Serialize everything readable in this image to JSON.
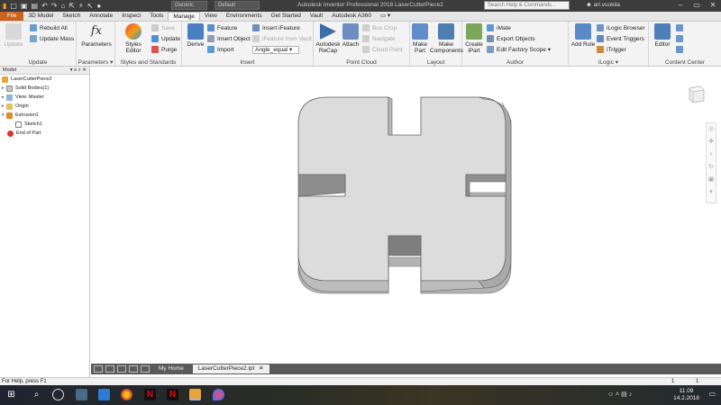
{
  "titlebar": {
    "title": "Autodesk Inventor Professional 2018    LaserCutterPiece2",
    "search_placeholder": "Search Help & Commands...",
    "user": "ari.vuokila",
    "appearance_combo": "Generic",
    "material_combo": "Default"
  },
  "tabs": [
    "File",
    "3D Model",
    "Sketch",
    "Annotate",
    "Inspect",
    "Tools",
    "Manage",
    "View",
    "Environments",
    "Get Started",
    "Vault",
    "Autodesk A360"
  ],
  "ribbon": {
    "update": {
      "update_label": "Update",
      "rebuild_all": "Rebuild All",
      "update_mass": "Update Mass",
      "panel": "Update"
    },
    "parameters": {
      "label": "Parameters",
      "panel": "Parameters"
    },
    "styles": {
      "editor": "Styles Editor",
      "save": "Save",
      "update": "Update",
      "purge": "Purge",
      "panel": "Styles and Standards"
    },
    "insert": {
      "derive": "Derive",
      "feature": "Feature",
      "insert_object": "Insert Object",
      "import": "Import",
      "insert_ifeature": "Insert iFeature",
      "ifeature_from_vault": "iFeature from Vault",
      "angle_equal": "Angle_equal",
      "panel": "Insert"
    },
    "point_cloud": {
      "recap": "Autodesk ReCap",
      "attach": "Attach",
      "box_crop": "Box Crop",
      "navigate": "Navigate",
      "cloud_point": "Cloud Point",
      "panel": "Point Cloud"
    },
    "layout": {
      "make_part": "Make Part",
      "make_components": "Make Components",
      "panel": "Layout"
    },
    "author": {
      "create_ipart": "Create iPart",
      "imate": "iMate",
      "export_objects": "Export Objects",
      "edit_factory_scope": "Edit Factory Scope",
      "panel": "Author"
    },
    "ilogic": {
      "add_rule": "Add Rule",
      "ilogic_browser": "iLogic Browser",
      "event_triggers": "Event Triggers",
      "itrigger": "iTrigger",
      "panel": "iLogic"
    },
    "content_center": {
      "editor": "Editor",
      "panel": "Content Center"
    }
  },
  "browser": {
    "header": "Model",
    "items": [
      "LaserCutterPiece2",
      "Solid Bodies(1)",
      "View: Master",
      "Origin",
      "Extrusion1",
      "Sketch1",
      "End of Part"
    ]
  },
  "doc_tabs": {
    "home": "My Home",
    "active": "LaserCutterPiece2.ipt"
  },
  "status": {
    "help": "For Help, press F1",
    "num1": "1",
    "num2": "1"
  },
  "taskbar": {
    "time": "11.09",
    "date": "14.2.2018"
  },
  "colors": {
    "file_tab": "#c8641e",
    "model_face": "#dcdcdc",
    "model_shadow": "#a6a6a6"
  }
}
